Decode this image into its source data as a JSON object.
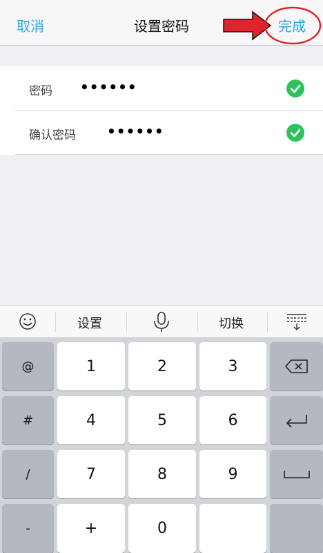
{
  "nav": {
    "cancel": "取消",
    "title": "设置密码",
    "done": "完成"
  },
  "form": {
    "rows": [
      {
        "label": "密码",
        "value": "••••••"
      },
      {
        "label": "确认密码",
        "value": "••••••"
      }
    ]
  },
  "toolbar": {
    "emoji_icon": "smiley-face-icon",
    "settings": "设置",
    "mic_icon": "microphone-icon",
    "switch": "切换",
    "collapse_icon": "keyboard-collapse-icon"
  },
  "keyboard": {
    "rows": [
      [
        "@",
        "1",
        "2",
        "3",
        "backspace"
      ],
      [
        "#",
        "4",
        "5",
        "6",
        "return"
      ],
      [
        "/",
        "7",
        "8",
        "9",
        "space"
      ],
      [
        "-",
        "+",
        "0",
        "",
        ""
      ]
    ]
  },
  "colors": {
    "accent": "#2aa7e6",
    "check": "#2ec25d",
    "annotation_red": "#e0242b"
  }
}
